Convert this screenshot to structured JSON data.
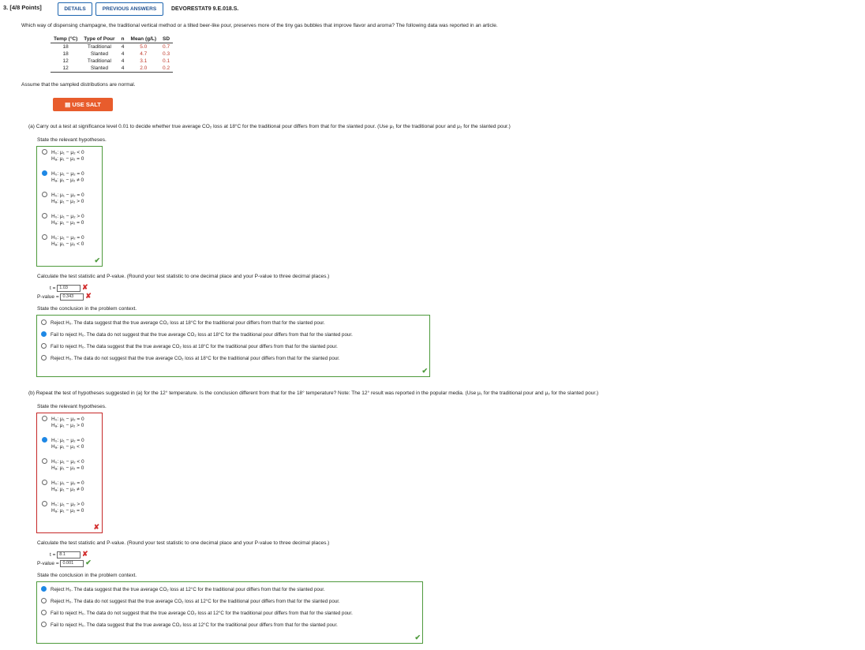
{
  "header": {
    "question_number": "3. [4/8 Points]",
    "details_button": "DETAILS",
    "previous_answers_button": "PREVIOUS ANSWERS",
    "problem_id": "DEVORESTAT9 9.E.018.S."
  },
  "question_text": "Which way of dispensing champagne, the traditional vertical method or a tilted beer-like pour, preserves more of the tiny gas bubbles that improve flavor and aroma? The following data was reported in an article.",
  "table": {
    "headers": [
      "Temp (°C)",
      "Type of Pour",
      "n",
      "Mean (g/L)",
      "SD"
    ],
    "rows": [
      [
        "18",
        "Traditional",
        "4",
        "5.0",
        "0.7"
      ],
      [
        "18",
        "Slanted",
        "4",
        "4.7",
        "0.3"
      ],
      [
        "12",
        "Traditional",
        "4",
        "3.1",
        "0.1"
      ],
      [
        "12",
        "Slanted",
        "4",
        "2.0",
        "0.2"
      ]
    ]
  },
  "assume_text": "Assume that the sampled distributions are normal.",
  "use_salt_button": "USE SALT",
  "part_a": {
    "prompt": "(a)  Carry out a test at significance level 0.01 to decide whether true average CO₂ loss at 18°C for the traditional pour differs from that for the slanted pour. (Use μ₁ for the traditional pour and μ₂ for the slanted pour.)",
    "hypotheses_label": "State the relevant hypotheses.",
    "hypotheses": [
      {
        "h0": "H₀: μ₁ − μ₂ < 0",
        "ha": "Hₐ: μ₁ − μ₂ = 0",
        "selected": false
      },
      {
        "h0": "H₀: μ₁ − μ₂ = 0",
        "ha": "Hₐ: μ₁ − μ₂ ≠ 0",
        "selected": true
      },
      {
        "h0": "H₀: μ₁ − μ₂ = 0",
        "ha": "Hₐ: μ₁ − μ₂ > 0",
        "selected": false
      },
      {
        "h0": "H₀: μ₁ − μ₂ > 0",
        "ha": "Hₐ: μ₁ − μ₂ = 0",
        "selected": false
      },
      {
        "h0": "H₀: μ₁ − μ₂ = 0",
        "ha": "Hₐ: μ₁ − μ₂ < 0",
        "selected": false
      }
    ],
    "calc_label": "Calculate the test statistic and P-value. (Round your test statistic to one decimal place and your P-value to three decimal places.)",
    "t_label": "t =",
    "t_value": "1.03",
    "p_label": "P-value =",
    "p_value": "0.343",
    "conclusion_label": "State the conclusion in the problem context.",
    "conclusions": [
      {
        "text": "Reject H₀. The data suggest that the true average CO₂ loss at 18°C for the traditional pour differs from that for the slanted pour.",
        "selected": false
      },
      {
        "text": "Fail to reject H₀. The data do not suggest that the true average CO₂ loss at 18°C for the traditional pour differs from that for the slanted pour.",
        "selected": true
      },
      {
        "text": "Fail to reject H₀. The data suggest that the true average CO₂ loss at 18°C for the traditional pour differs from that for the slanted pour.",
        "selected": false
      },
      {
        "text": "Reject H₀. The data do not suggest that the true average CO₂ loss at 18°C for the traditional pour differs from that for the slanted pour.",
        "selected": false
      }
    ]
  },
  "part_b": {
    "prompt": "(b)  Repeat the test of hypotheses suggested in (a) for the 12° temperature. Is the conclusion different from that for the 18° temperature? Note: The 12° result was reported in the popular media. (Use μ₁ for the traditional pour and μ₂ for the slanted pour.)",
    "hypotheses_label": "State the relevant hypotheses.",
    "hypotheses": [
      {
        "h0": "H₀: μ₁ − μ₂ = 0",
        "ha": "Hₐ: μ₁ − μ₂ > 0",
        "selected": false
      },
      {
        "h0": "H₀: μ₁ − μ₂ = 0",
        "ha": "Hₐ: μ₁ − μ₂ < 0",
        "selected": true
      },
      {
        "h0": "H₀: μ₁ − μ₂ < 0",
        "ha": "Hₐ: μ₁ − μ₂ = 0",
        "selected": false
      },
      {
        "h0": "H₀: μ₁ − μ₂ = 0",
        "ha": "Hₐ: μ₁ − μ₂ ≠ 0",
        "selected": false
      },
      {
        "h0": "H₀: μ₁ − μ₂ > 0",
        "ha": "Hₐ: μ₁ − μ₂ = 0",
        "selected": false
      }
    ],
    "calc_label": "Calculate the test statistic and P-value. (Round your test statistic to one decimal place and your P-value to three decimal places.)",
    "t_label": "t =",
    "t_value": "8.1",
    "p_label": "P-value =",
    "p_value": "0.001",
    "conclusion_label": "State the conclusion in the problem context.",
    "conclusions": [
      {
        "text": "Reject H₀. The data suggest that the true average CO₂ loss at 12°C for the traditional pour differs from that for the slanted pour.",
        "selected": true
      },
      {
        "text": "Reject H₀. The data do not suggest that the true average CO₂ loss at 12°C for the traditional pour differs from that for the slanted pour.",
        "selected": false
      },
      {
        "text": "Fail to reject H₀. The data do not suggest that the true average CO₂ loss at 12°C for the traditional pour differs from that for the slanted pour.",
        "selected": false
      },
      {
        "text": "Fail to reject H₀. The data suggest that the true average CO₂ loss at 12°C for the traditional pour differs from that for the slanted pour.",
        "selected": false
      }
    ]
  },
  "colors": {
    "correct": "#4e9a3c",
    "incorrect": "#c62828",
    "selected_radio": "#1e88e5",
    "salt_button": "#e85c2c"
  }
}
